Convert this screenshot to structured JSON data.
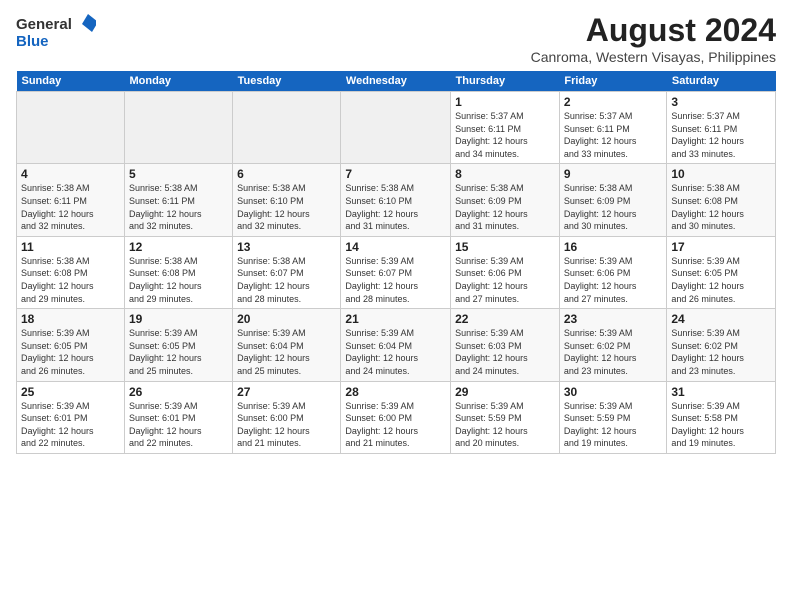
{
  "logo": {
    "line1": "General",
    "line2": "Blue"
  },
  "title": "August 2024",
  "subtitle": "Canroma, Western Visayas, Philippines",
  "days_header": [
    "Sunday",
    "Monday",
    "Tuesday",
    "Wednesday",
    "Thursday",
    "Friday",
    "Saturday"
  ],
  "weeks": [
    [
      {
        "day": "",
        "info": ""
      },
      {
        "day": "",
        "info": ""
      },
      {
        "day": "",
        "info": ""
      },
      {
        "day": "",
        "info": ""
      },
      {
        "day": "1",
        "info": "Sunrise: 5:37 AM\nSunset: 6:11 PM\nDaylight: 12 hours\nand 34 minutes."
      },
      {
        "day": "2",
        "info": "Sunrise: 5:37 AM\nSunset: 6:11 PM\nDaylight: 12 hours\nand 33 minutes."
      },
      {
        "day": "3",
        "info": "Sunrise: 5:37 AM\nSunset: 6:11 PM\nDaylight: 12 hours\nand 33 minutes."
      }
    ],
    [
      {
        "day": "4",
        "info": "Sunrise: 5:38 AM\nSunset: 6:11 PM\nDaylight: 12 hours\nand 32 minutes."
      },
      {
        "day": "5",
        "info": "Sunrise: 5:38 AM\nSunset: 6:11 PM\nDaylight: 12 hours\nand 32 minutes."
      },
      {
        "day": "6",
        "info": "Sunrise: 5:38 AM\nSunset: 6:10 PM\nDaylight: 12 hours\nand 32 minutes."
      },
      {
        "day": "7",
        "info": "Sunrise: 5:38 AM\nSunset: 6:10 PM\nDaylight: 12 hours\nand 31 minutes."
      },
      {
        "day": "8",
        "info": "Sunrise: 5:38 AM\nSunset: 6:09 PM\nDaylight: 12 hours\nand 31 minutes."
      },
      {
        "day": "9",
        "info": "Sunrise: 5:38 AM\nSunset: 6:09 PM\nDaylight: 12 hours\nand 30 minutes."
      },
      {
        "day": "10",
        "info": "Sunrise: 5:38 AM\nSunset: 6:08 PM\nDaylight: 12 hours\nand 30 minutes."
      }
    ],
    [
      {
        "day": "11",
        "info": "Sunrise: 5:38 AM\nSunset: 6:08 PM\nDaylight: 12 hours\nand 29 minutes."
      },
      {
        "day": "12",
        "info": "Sunrise: 5:38 AM\nSunset: 6:08 PM\nDaylight: 12 hours\nand 29 minutes."
      },
      {
        "day": "13",
        "info": "Sunrise: 5:38 AM\nSunset: 6:07 PM\nDaylight: 12 hours\nand 28 minutes."
      },
      {
        "day": "14",
        "info": "Sunrise: 5:39 AM\nSunset: 6:07 PM\nDaylight: 12 hours\nand 28 minutes."
      },
      {
        "day": "15",
        "info": "Sunrise: 5:39 AM\nSunset: 6:06 PM\nDaylight: 12 hours\nand 27 minutes."
      },
      {
        "day": "16",
        "info": "Sunrise: 5:39 AM\nSunset: 6:06 PM\nDaylight: 12 hours\nand 27 minutes."
      },
      {
        "day": "17",
        "info": "Sunrise: 5:39 AM\nSunset: 6:05 PM\nDaylight: 12 hours\nand 26 minutes."
      }
    ],
    [
      {
        "day": "18",
        "info": "Sunrise: 5:39 AM\nSunset: 6:05 PM\nDaylight: 12 hours\nand 26 minutes."
      },
      {
        "day": "19",
        "info": "Sunrise: 5:39 AM\nSunset: 6:05 PM\nDaylight: 12 hours\nand 25 minutes."
      },
      {
        "day": "20",
        "info": "Sunrise: 5:39 AM\nSunset: 6:04 PM\nDaylight: 12 hours\nand 25 minutes."
      },
      {
        "day": "21",
        "info": "Sunrise: 5:39 AM\nSunset: 6:04 PM\nDaylight: 12 hours\nand 24 minutes."
      },
      {
        "day": "22",
        "info": "Sunrise: 5:39 AM\nSunset: 6:03 PM\nDaylight: 12 hours\nand 24 minutes."
      },
      {
        "day": "23",
        "info": "Sunrise: 5:39 AM\nSunset: 6:02 PM\nDaylight: 12 hours\nand 23 minutes."
      },
      {
        "day": "24",
        "info": "Sunrise: 5:39 AM\nSunset: 6:02 PM\nDaylight: 12 hours\nand 23 minutes."
      }
    ],
    [
      {
        "day": "25",
        "info": "Sunrise: 5:39 AM\nSunset: 6:01 PM\nDaylight: 12 hours\nand 22 minutes."
      },
      {
        "day": "26",
        "info": "Sunrise: 5:39 AM\nSunset: 6:01 PM\nDaylight: 12 hours\nand 22 minutes."
      },
      {
        "day": "27",
        "info": "Sunrise: 5:39 AM\nSunset: 6:00 PM\nDaylight: 12 hours\nand 21 minutes."
      },
      {
        "day": "28",
        "info": "Sunrise: 5:39 AM\nSunset: 6:00 PM\nDaylight: 12 hours\nand 21 minutes."
      },
      {
        "day": "29",
        "info": "Sunrise: 5:39 AM\nSunset: 5:59 PM\nDaylight: 12 hours\nand 20 minutes."
      },
      {
        "day": "30",
        "info": "Sunrise: 5:39 AM\nSunset: 5:59 PM\nDaylight: 12 hours\nand 19 minutes."
      },
      {
        "day": "31",
        "info": "Sunrise: 5:39 AM\nSunset: 5:58 PM\nDaylight: 12 hours\nand 19 minutes."
      }
    ]
  ]
}
